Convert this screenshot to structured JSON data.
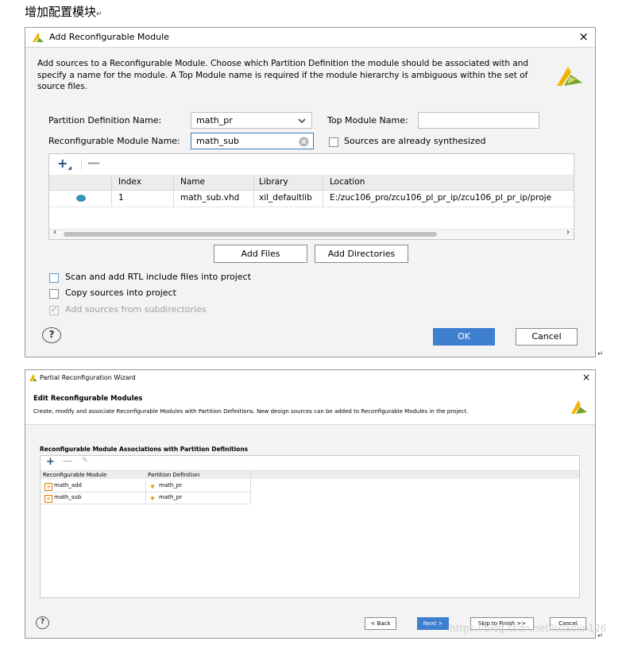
{
  "heading": "增加配置模块",
  "return_mark": "↵",
  "dialog1": {
    "title": "Add Reconfigurable Module",
    "close_icon": "×",
    "description": "Add sources to a Reconfigurable Module. Choose which Partition Definition the module should be associated with and specify a name for the module. A Top Module name is required if the module hierarchy is ambiguous within the set of source files.",
    "partition_label": "Partition Definition Name:",
    "partition_value": "math_pr",
    "top_module_label": "Top Module Name:",
    "top_module_value": "",
    "rm_name_label": "Reconfigurable Module Name:",
    "rm_name_value": "math_sub",
    "synth_label": "Sources are already synthesized",
    "table": {
      "columns": [
        "Index",
        "Name",
        "Library",
        "Location"
      ],
      "rows": [
        {
          "index": "1",
          "name": "math_sub.vhd",
          "library": "xil_defaultlib",
          "location": "E:/zuc106_pro/zcu106_pl_pr_ip/zcu106_pl_pr_ip/proje"
        }
      ]
    },
    "add_files": "Add Files",
    "add_dirs": "Add Directories",
    "opt_scan": "Scan and add RTL include files into project",
    "opt_copy": "Copy sources into project",
    "opt_subdir": "Add sources from subdirectories",
    "help": "?",
    "ok": "OK",
    "cancel": "Cancel"
  },
  "dialog2": {
    "title": "Partial Reconfiguration Wizard",
    "close_icon": "×",
    "header_title": "Edit Reconfigurable Modules",
    "header_desc": "Create, modify and associate Reconfigurable Modules with Partition Definitions. New design sources can be added to Reconfigurable Modules in the project.",
    "section_title": "Reconfigurable Module Associations with Partition Definitions",
    "columns": [
      "Reconfigurable Module",
      "Partition Definition"
    ],
    "rows": [
      {
        "module": "math_add",
        "partition": "math_pr"
      },
      {
        "module": "math_sub",
        "partition": "math_pr"
      }
    ],
    "help": "?",
    "back": "< Back",
    "next": "Next >",
    "skip": "Skip to Finish >>",
    "cancel": "Cancel"
  },
  "watermark": "https://blog.csdn.net/lixiaolin126",
  "colors": {
    "accent": "#3f7fd0",
    "brand_yellow": "#f0b400",
    "brand_green": "#7aa32a",
    "diamond": "#f0a020",
    "module_icon": "#e07b00"
  }
}
